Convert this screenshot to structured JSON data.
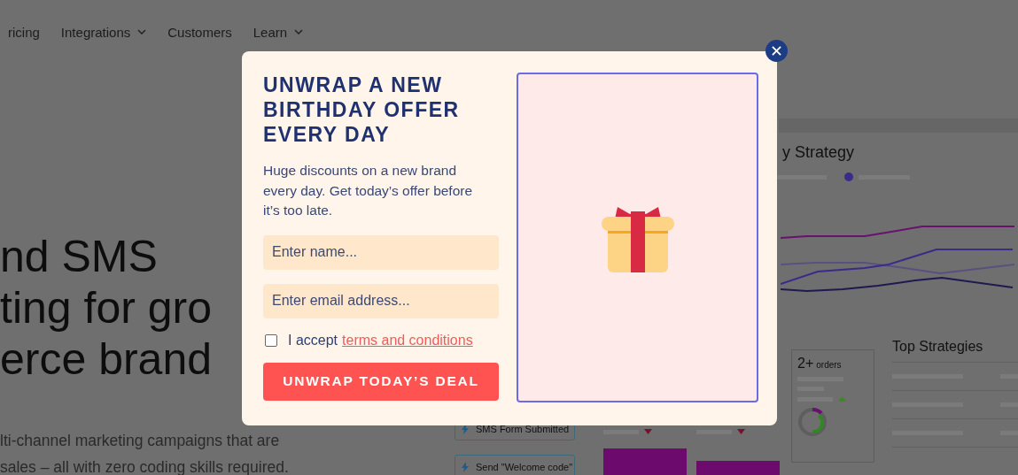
{
  "nav": {
    "items": [
      {
        "label": "ricing",
        "dropdown": false
      },
      {
        "label": "Integrations",
        "dropdown": true
      },
      {
        "label": "Customers",
        "dropdown": false
      },
      {
        "label": "Learn",
        "dropdown": true
      }
    ]
  },
  "hero": {
    "title_lines": [
      "nd SMS",
      "ting for gro",
      "erce brand"
    ],
    "description_lines": [
      "lti-channel marketing campaigns that are",
      "sales – all with zero coding skills required."
    ]
  },
  "dashboard": {
    "flow_steps": [
      {
        "label": "SMS Form Submitted"
      },
      {
        "label": "Send \"Welcome code\""
      }
    ],
    "chart_title": "y Strategy",
    "orders_card": {
      "value": "2+",
      "unit": "orders"
    },
    "top_strategies_title": "Top Strategies"
  },
  "popup": {
    "title": "UNWRAP A NEW BIRTHDAY OFFER EVERY DAY",
    "description": "Huge discounts on a new brand every day. Get today’s offer before it’s too late.",
    "fields": [
      {
        "placeholder": "Enter name..."
      },
      {
        "placeholder": "Enter email address..."
      }
    ],
    "consent": {
      "checked": false,
      "text": "I accept",
      "link": "terms and conditions"
    },
    "submit": "UNWRAP TODAY’S DEAL"
  }
}
